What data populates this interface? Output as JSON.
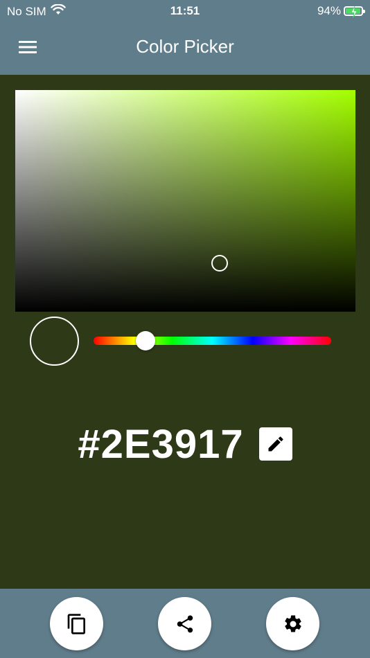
{
  "status_bar": {
    "carrier": "No SIM",
    "time": "11:51",
    "battery_percent": "94%",
    "battery_level": 0.94,
    "charging": true
  },
  "app_bar": {
    "title": "Color Picker",
    "menu_icon": "menu-icon"
  },
  "picker": {
    "hue_color": "#a4ff00",
    "hue_position": 0.22,
    "saturation": 0.6,
    "value": 0.22,
    "selected_color": "#2E3917"
  },
  "hex_display": {
    "value": "#2E3917",
    "edit_icon": "pencil-icon"
  },
  "bottom_actions": [
    {
      "name": "copy",
      "icon": "copy-icon"
    },
    {
      "name": "share",
      "icon": "share-icon"
    },
    {
      "name": "settings",
      "icon": "gear-icon"
    }
  ],
  "colors": {
    "bar": "#607d8b",
    "background": "#2e3917",
    "accent": "#ffffff"
  }
}
